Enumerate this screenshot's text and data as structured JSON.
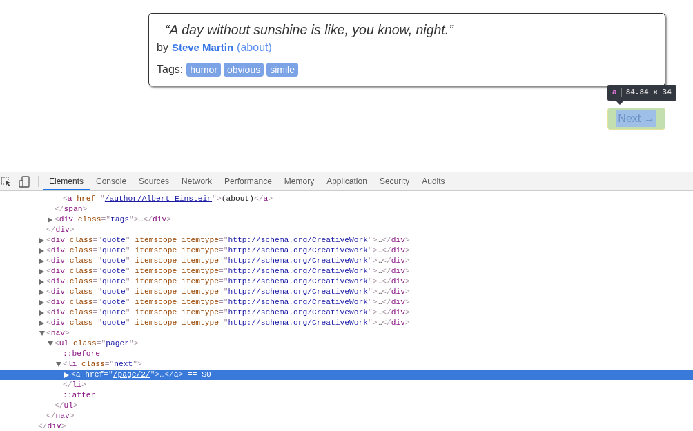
{
  "quote_card": {
    "text": "“A day without sunshine is like, you know, night.”",
    "by": "by",
    "author": "Steve Martin",
    "about": "(about)",
    "tags_label": "Tags:",
    "tags": [
      "humor",
      "obvious",
      "simile"
    ]
  },
  "inspect_tooltip": {
    "tag": "a",
    "size": "84.84 × 34"
  },
  "next_link": {
    "label": "Next →",
    "highlighted": true
  },
  "devtools": {
    "tabs": [
      {
        "label": "Elements",
        "selected": true
      },
      {
        "label": "Console",
        "selected": false
      },
      {
        "label": "Sources",
        "selected": false
      },
      {
        "label": "Network",
        "selected": false
      },
      {
        "label": "Performance",
        "selected": false
      },
      {
        "label": "Memory",
        "selected": false
      },
      {
        "label": "Application",
        "selected": false
      },
      {
        "label": "Security",
        "selected": false
      },
      {
        "label": "Audits",
        "selected": false
      }
    ],
    "elements_tree": [
      {
        "children": [
          {
            "children": [
              {
                "children": [
                  {
                    "open": "<a href=\"/author/Albert-Einstein\">(about)</a>",
                    "selected": false
                  }
                ]
              },
              {
                "open": "</span>",
                "selected": false
              },
              {
                "open": "<div class=\"tags\">…</div>",
                "expanded": false,
                "selected": false
              }
            ]
          },
          {
            "open": "</div>",
            "selected": false
          },
          {
            "open": "<div class=\"quote\" itemscope itemtype=\"http://schema.org/CreativeWork\">…</div>",
            "expanded": false,
            "selected": false
          },
          {
            "open": "<div class=\"quote\" itemscope itemtype=\"http://schema.org/CreativeWork\">…</div>",
            "expanded": false,
            "selected": false
          },
          {
            "open": "<div class=\"quote\" itemscope itemtype=\"http://schema.org/CreativeWork\">…</div>",
            "expanded": false,
            "selected": false
          },
          {
            "open": "<div class=\"quote\" itemscope itemtype=\"http://schema.org/CreativeWork\">…</div>",
            "expanded": false,
            "selected": false
          },
          {
            "open": "<div class=\"quote\" itemscope itemtype=\"http://schema.org/CreativeWork\">…</div>",
            "expanded": false,
            "selected": false
          },
          {
            "open": "<div class=\"quote\" itemscope itemtype=\"http://schema.org/CreativeWork\">…</div>",
            "expanded": false,
            "selected": false
          },
          {
            "open": "<div class=\"quote\" itemscope itemtype=\"http://schema.org/CreativeWork\">…</div>",
            "expanded": false,
            "selected": false
          },
          {
            "open": "<div class=\"quote\" itemscope itemtype=\"http://schema.org/CreativeWork\">…</div>",
            "expanded": false,
            "selected": false
          },
          {
            "open": "<div class=\"quote\" itemscope itemtype=\"http://schema.org/CreativeWork\">…</div>",
            "expanded": false,
            "selected": false
          },
          {
            "open": "<nav>",
            "expanded": true,
            "selected": false,
            "children": [
              {
                "open": "<ul class=\"pager\">",
                "expanded": true,
                "selected": false,
                "children": [
                  {
                    "open": "::before",
                    "selected": false
                  },
                  {
                    "open": "<li class=\"next\">",
                    "expanded": true,
                    "selected": false,
                    "children": [
                      {
                        "open": "<a href=\"/page/2/\">…</a> == $0",
                        "expanded": false,
                        "selected": true
                      }
                    ]
                  },
                  {
                    "open": "</li>",
                    "selected": false
                  },
                  {
                    "open": "::after",
                    "selected": false
                  }
                ]
              },
              {
                "open": "</ul>",
                "selected": false
              }
            ]
          },
          {
            "open": "</nav>",
            "selected": false
          }
        ]
      },
      {
        "open": "</div>",
        "selected": false
      }
    ]
  }
}
